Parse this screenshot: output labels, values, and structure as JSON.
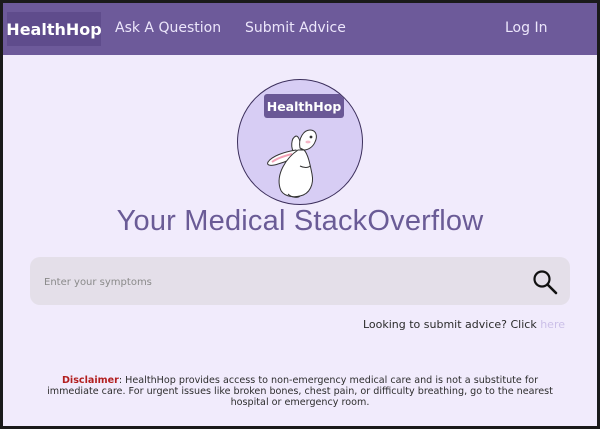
{
  "navbar": {
    "brand": "HealthHop",
    "links": [
      "Ask A Question",
      "Submit Advice"
    ],
    "login": "Log In"
  },
  "logo": {
    "badge": "HealthHop"
  },
  "headline": "Your Medical StackOverflow",
  "search": {
    "placeholder": "Enter your symptoms",
    "icon": "search-icon"
  },
  "submit_advice": {
    "text": "Looking to submit advice? Click ",
    "link": "here"
  },
  "disclaimer": {
    "label": "Disclaimer",
    "text": ": HealthHop provides access to non-emergency medical care and is not a substitute for immediate care. For urgent issues like broken bones, chest pain, or difficulty breathing, go to the nearest hospital or emergency room."
  },
  "colors": {
    "navbar": "#6d5a9a",
    "background": "#f1ebfc",
    "headline": "#6a5b96",
    "disclaimer_label": "#b21e1e"
  }
}
